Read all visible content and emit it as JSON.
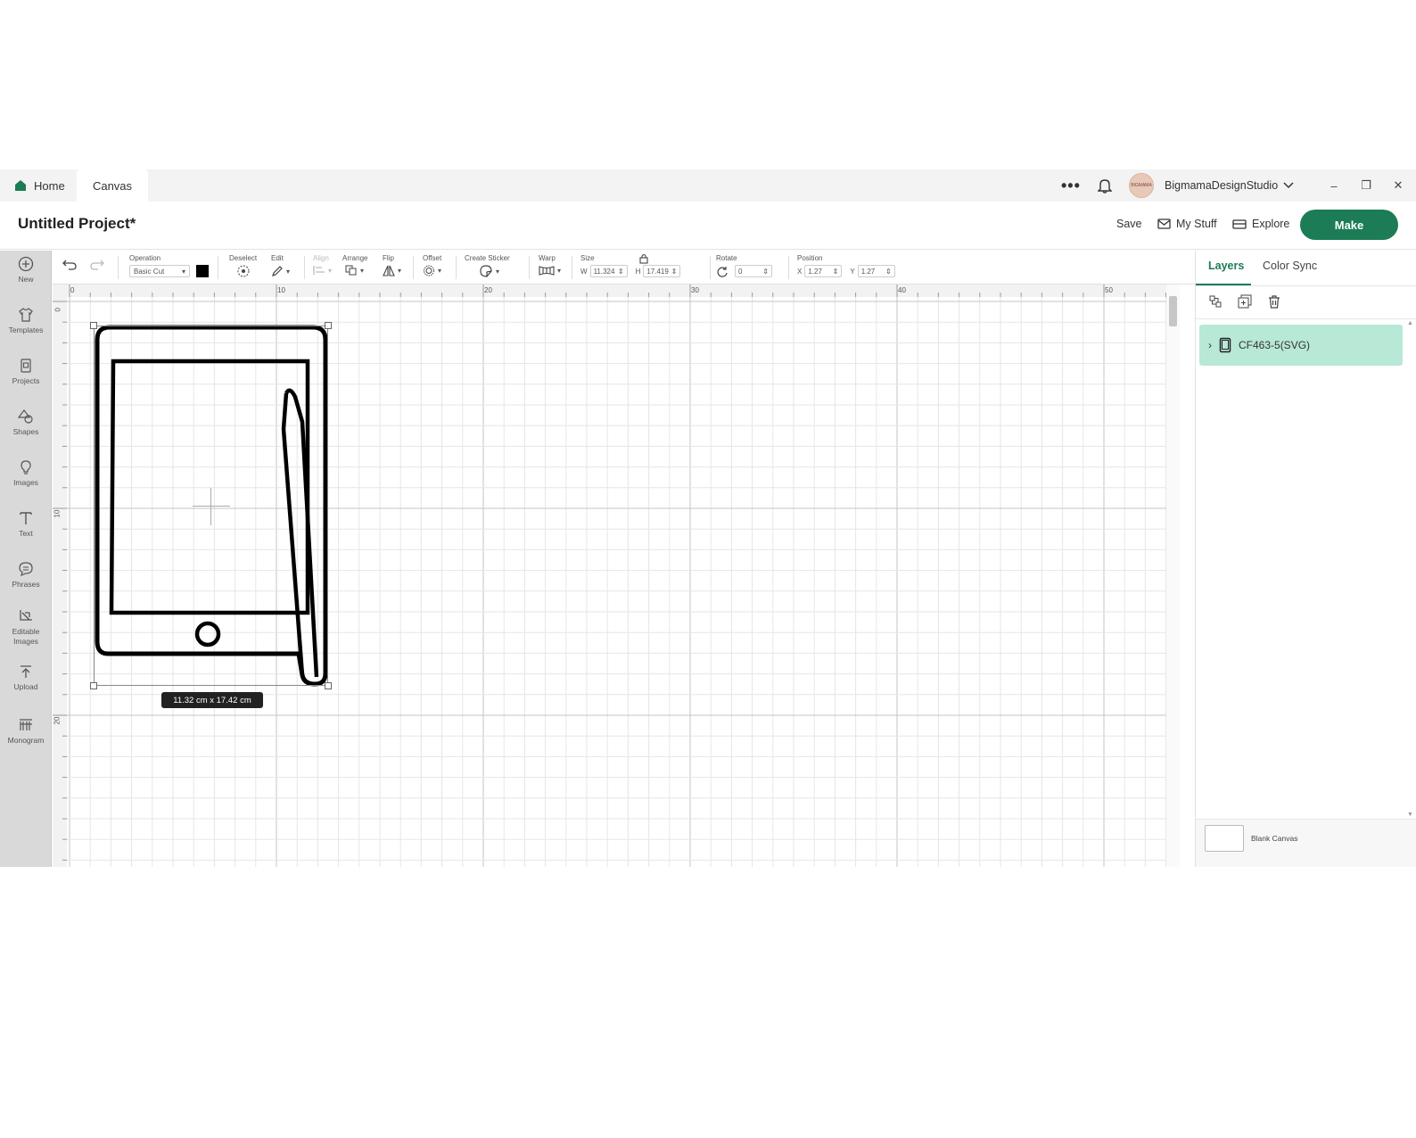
{
  "titlebar": {
    "home_label": "Home",
    "canvas_label": "Canvas",
    "more_label": "•••",
    "user_name": "BigmamaDesignStudio",
    "avatar_text": "BIGMAMA",
    "minimize": "–",
    "restore": "❐",
    "close": "✕"
  },
  "project": {
    "title": "Untitled Project*",
    "save_label": "Save",
    "mystuff_label": "My Stuff",
    "explore_label": "Explore",
    "make_label": "Make"
  },
  "rail": {
    "items": [
      {
        "label": "New",
        "icon": "plus-circle-icon"
      },
      {
        "label": "Templates",
        "icon": "shirt-icon"
      },
      {
        "label": "Projects",
        "icon": "projects-icon"
      },
      {
        "label": "Shapes",
        "icon": "shapes-icon"
      },
      {
        "label": "Images",
        "icon": "lightbulb-icon"
      },
      {
        "label": "Text",
        "icon": "text-icon"
      },
      {
        "label": "Phrases",
        "icon": "speech-bubble-icon"
      },
      {
        "label": "Editable\nImages",
        "icon": "editable-images-icon"
      },
      {
        "label": "Upload",
        "icon": "upload-icon"
      },
      {
        "label": "Monogram",
        "icon": "monogram-icon"
      }
    ]
  },
  "toolbar": {
    "operation_label": "Operation",
    "operation_value": "Basic Cut",
    "operation_color": "#000000",
    "deselect_label": "Deselect",
    "edit_label": "Edit",
    "align_label": "Align",
    "arrange_label": "Arrange",
    "flip_label": "Flip",
    "offset_label": "Offset",
    "sticker_label": "Create Sticker",
    "warp_label": "Warp",
    "size_label": "Size",
    "w_label": "W",
    "w_value": "11.324",
    "h_label": "H",
    "h_value": "17.419",
    "rotate_label": "Rotate",
    "rotate_value": "0",
    "position_label": "Position",
    "x_label": "X",
    "x_value": "1.27",
    "y_label": "Y",
    "y_value": "1.27"
  },
  "canvas": {
    "ruler_top": [
      "0",
      "10",
      "20",
      "30",
      "40",
      "50"
    ],
    "ruler_left": [
      "0",
      "10",
      "20"
    ],
    "size_tag": "11.32  cm x 17.42  cm"
  },
  "panel": {
    "tab_layers": "Layers",
    "tab_colorsync": "Color Sync",
    "layer_name": "CF463-5(SVG)",
    "blank_canvas": "Blank Canvas"
  },
  "colors": {
    "accent": "#1c7c55",
    "layer_selected": "#b8e8d6",
    "rail_bg": "#d9d9d9"
  }
}
